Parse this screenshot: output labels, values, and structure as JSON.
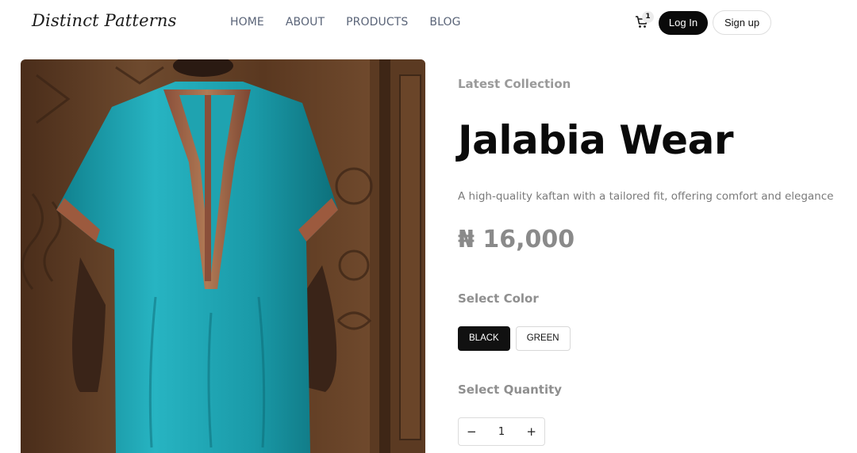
{
  "header": {
    "logo_text": "Distinct Patterns",
    "nav": [
      "HOME",
      "ABOUT",
      "PRODUCTS",
      "BLOG"
    ],
    "cart_count": "1",
    "login_label": "Log In",
    "signup_label": "Sign up"
  },
  "product": {
    "eyebrow": "Latest Collection",
    "title": "Jalabia Wear",
    "description": "A high-quality kaftan with a tailored fit, offering comfort and elegance",
    "price": "₦ 16,000",
    "color_label": "Select Color",
    "colors": [
      "BLACK",
      "GREEN"
    ],
    "selected_color": "BLACK",
    "quantity_label": "Select Quantity",
    "quantity": "1",
    "decrement_symbol": "−",
    "increment_symbol": "+"
  },
  "icons": [
    "cart-icon",
    "minus-icon",
    "plus-icon"
  ],
  "colors": {
    "accent": "#0a0a0a",
    "garment": "#1fa3b0",
    "wood": "#6b4226"
  }
}
